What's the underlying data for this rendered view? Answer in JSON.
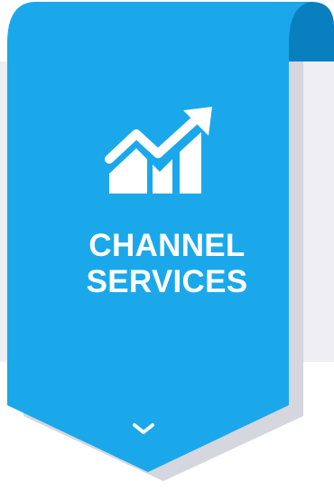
{
  "banner": {
    "title_line1": "CHANNEL",
    "title_line2": "SERVICES",
    "icon": "growth-chart-icon",
    "expand_icon": "chevron-down-icon"
  },
  "colors": {
    "banner_blue": "#1aa8eb",
    "fold_blue": "#0a7fc0",
    "shadow_gray": "#d6d6de",
    "backdrop_gray": "#eeeef3",
    "text_white": "#ffffff"
  }
}
